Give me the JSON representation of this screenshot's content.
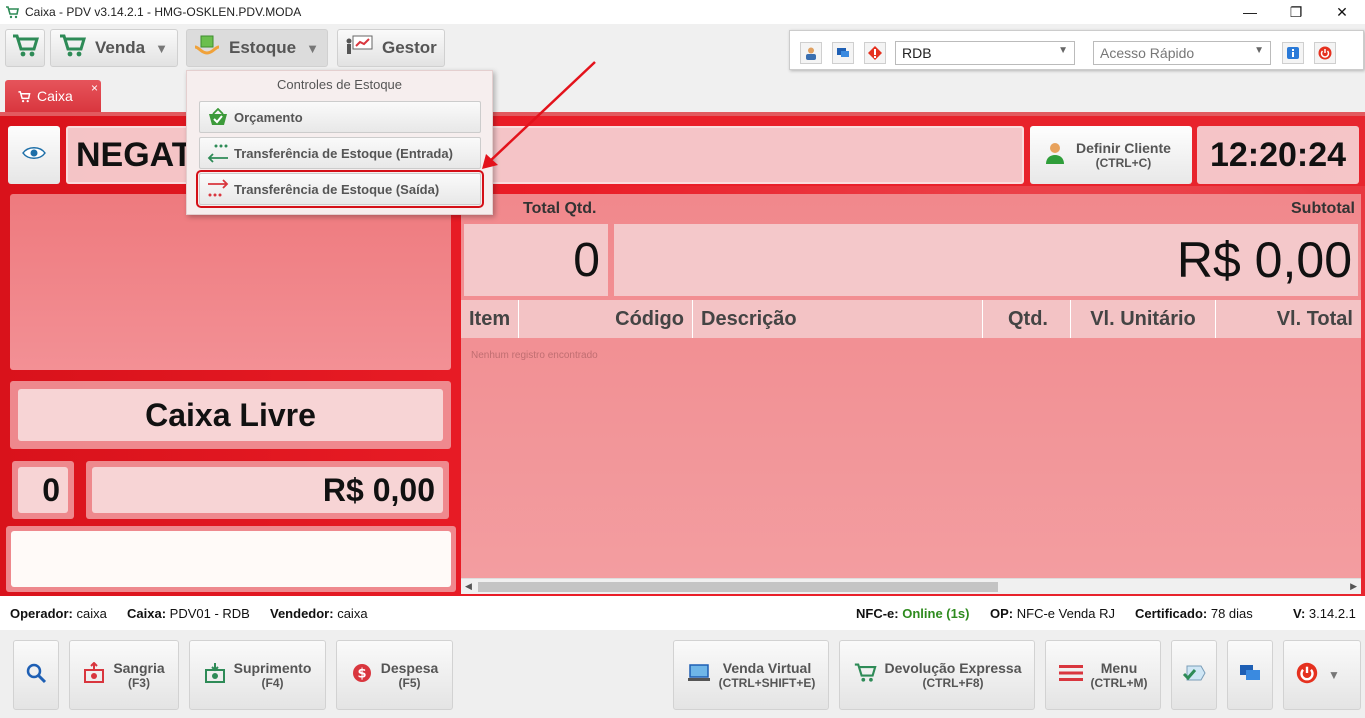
{
  "window": {
    "title": "Caixa - PDV v3.14.2.1 - HMG-OSKLEN.PDV.MODA",
    "minimize": "—",
    "maximize": "❐",
    "close": "✕"
  },
  "toolbar": {
    "venda_label": "Venda",
    "estoque_label": "Estoque",
    "gestor_label": "Gestor",
    "store_select": "RDB",
    "quick_access_placeholder": "Acesso Rápido"
  },
  "tabs": [
    {
      "label": "Caixa",
      "close": "×"
    }
  ],
  "dropdown": {
    "title": "Controles de Estoque",
    "items": [
      {
        "label": "Orçamento"
      },
      {
        "label": "Transferência de Estoque (Entrada)"
      },
      {
        "label": "Transferência de Estoque (Saída)"
      }
    ]
  },
  "main": {
    "product_text": "NEGAT",
    "cliente_label": "Definir Cliente",
    "cliente_shortcut": "(CTRL+C)",
    "clock": "12:20:24",
    "status": "Caixa Livre",
    "count": "0",
    "total": "R$ 0,00"
  },
  "summary": {
    "total_qtd_label": "Total Qtd.",
    "subtotal_label": "Subtotal",
    "total_qtd_value": "0",
    "subtotal_value": "R$ 0,00"
  },
  "grid": {
    "columns": [
      "Item",
      "Código",
      "Descrição",
      "Qtd.",
      "Vl. Unitário",
      "Vl. Total"
    ],
    "empty_message": "Nenhum registro encontrado"
  },
  "statusbar": {
    "operador_label": "Operador:",
    "operador": "caixa",
    "caixa_label": "Caixa:",
    "caixa": "PDV01 - RDB",
    "vendedor_label": "Vendedor:",
    "vendedor": "caixa",
    "nfce_label": "NFC-e:",
    "nfce": "Online (1s)",
    "op_label": "OP:",
    "op": "NFC-e Venda RJ",
    "cert_label": "Certificado:",
    "cert": "78 dias",
    "version_label": "V:",
    "version": "3.14.2.1"
  },
  "bottom": {
    "sangria": {
      "label": "Sangria",
      "shortcut": "(F3)"
    },
    "suprimento": {
      "label": "Suprimento",
      "shortcut": "(F4)"
    },
    "despesa": {
      "label": "Despesa",
      "shortcut": "(F5)"
    },
    "venda_virtual": {
      "label": "Venda Virtual",
      "shortcut": "(CTRL+SHIFT+E)"
    },
    "devolucao": {
      "label": "Devolução Expressa",
      "shortcut": "(CTRL+F8)"
    },
    "menu": {
      "label": "Menu",
      "shortcut": "(CTRL+M)"
    }
  },
  "colors": {
    "brand_red": "#e0161f",
    "highlight": "#d40f17",
    "online": "#2e8b1e",
    "cart_green": "#2e8b57"
  }
}
